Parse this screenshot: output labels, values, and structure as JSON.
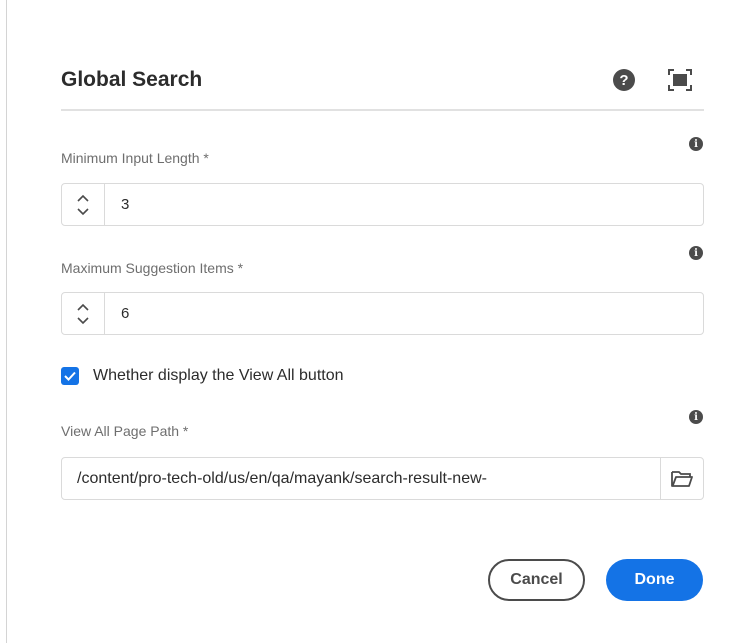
{
  "dialog": {
    "title": "Global Search",
    "help_glyph": "?",
    "help_icon": "help-circle-icon",
    "fullscreen_icon": "fullscreen-icon"
  },
  "fields": {
    "min_input": {
      "label": "Minimum Input Length *",
      "value": "3",
      "info_glyph": "i"
    },
    "max_items": {
      "label": "Maximum Suggestion Items *",
      "value": "6",
      "info_glyph": "i"
    },
    "view_all_checkbox": {
      "label": "Whether display the View All button",
      "checked": true
    },
    "page_path": {
      "label": "View All Page Path *",
      "value": "/content/pro-tech-old/us/en/qa/mayank/search-result-new-",
      "info_glyph": "i",
      "browse_icon": "folder-open-icon"
    }
  },
  "actions": {
    "cancel_label": "Cancel",
    "done_label": "Done"
  },
  "colors": {
    "accent": "#1473e6",
    "text": "#2c2c2c",
    "label": "#6e6e6e",
    "border": "#dadada"
  }
}
